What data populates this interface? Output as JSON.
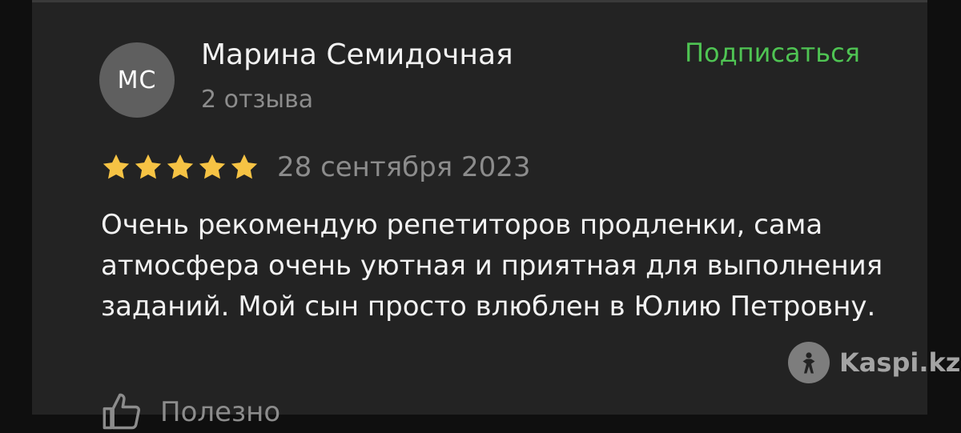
{
  "review": {
    "author": {
      "initials": "МС",
      "name": "Марина Семидочная",
      "reviews_count": "2 отзыва"
    },
    "subscribe_label": "Подписаться",
    "rating": 5,
    "rating_max": 5,
    "date": "28 сентября 2023",
    "text": "Очень рекомендую репетиторов продленки, сама атмосфера очень уютная и приятная для выполнения заданий. Мой сын просто влюблен в Юлию Петровну.",
    "helpful_label": "Полезно"
  },
  "watermark": {
    "text": "Kaspi.kz",
    "icon": "kaspi-logo-icon"
  },
  "colors": {
    "background": "#232323",
    "accent_green": "#4fc453",
    "star_gold": "#f6c344",
    "muted_text": "#8c8c8c",
    "primary_text": "#f2f2f2"
  }
}
